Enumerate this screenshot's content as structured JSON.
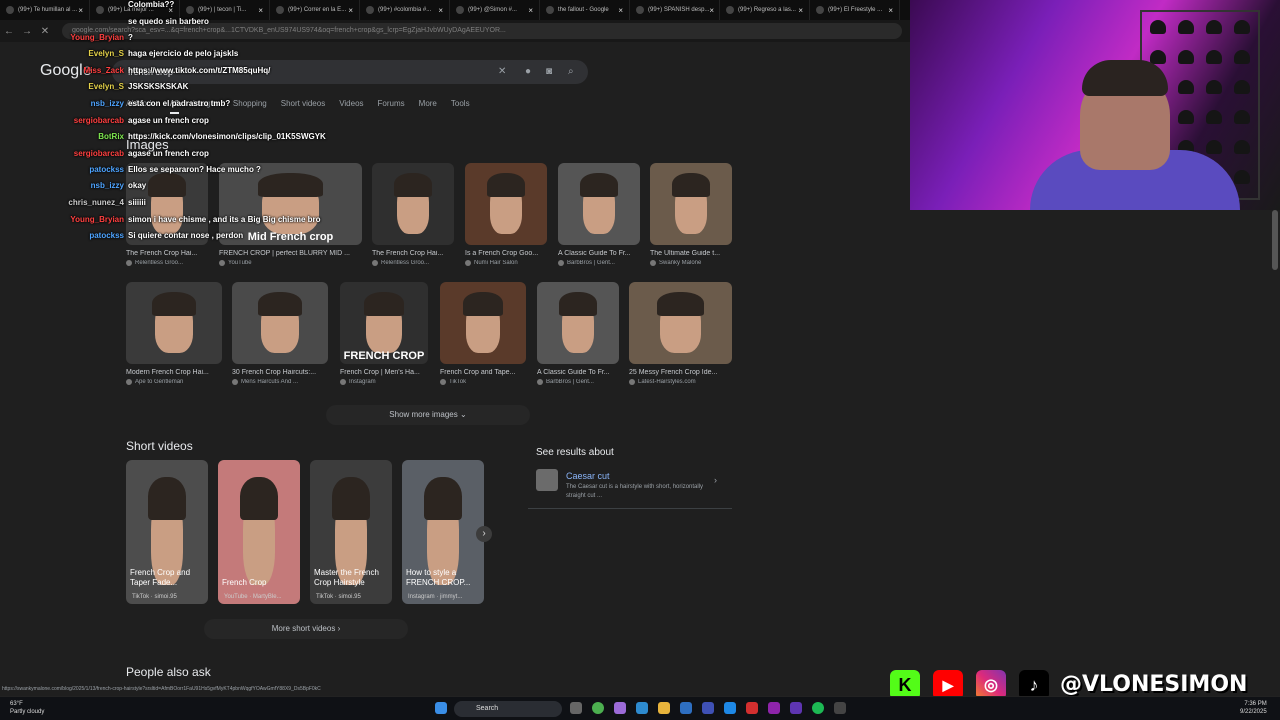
{
  "browser": {
    "tabs": [
      "(99+) Te humillan al ...",
      "(99+) La mejor ...",
      "(99+) | tecon | Ti...",
      "(99+) Correr en la E...",
      "(99+) #colombia #...",
      "(99+) @Simon #...",
      "the fallout - Google",
      "(99+) SPANISH desp...",
      "(99+) Regreso a las...",
      "(99+) El Freestyle ..."
    ],
    "url": "google.com/search?sca_esv=...&q=french+crop&...1CTVDKB_enUS974US974&oq=french+crop&gs_lcrp=EgZjaHJvbWUyDAgAEEUYOR..."
  },
  "google": {
    "logo": "Google",
    "query": "french crop",
    "filters": [
      "AI Mode",
      "All",
      "Images",
      "Shopping",
      "Short videos",
      "Videos",
      "Forums",
      "More",
      "Tools"
    ],
    "images_heading": "Images",
    "row1": [
      {
        "title": "The French Crop Hai...",
        "source": "Relentless Groo..."
      },
      {
        "title": "FRENCH CROP | perfect BLURRY MID ...",
        "source": "YouTube",
        "overlay": "Mid French crop"
      },
      {
        "title": "The French Crop Hai...",
        "source": "Relentless Groo..."
      },
      {
        "title": "Is a French Crop Goo...",
        "source": "Numi Hair Salon"
      },
      {
        "title": "A Classic Guide To Fr...",
        "source": "BarbBros | Gent..."
      },
      {
        "title": "The Ultimate Guide t...",
        "source": "Swanky Malone"
      }
    ],
    "row2": [
      {
        "title": "Modern French Crop Hai...",
        "source": "Ape to Gentleman"
      },
      {
        "title": "30 French Crop Haircuts:...",
        "source": "Mens Haircuts And ..."
      },
      {
        "title": "French Crop | Men's Ha...",
        "source": "Instagram",
        "overlay": "FRENCH CROP"
      },
      {
        "title": "French Crop and Tape...",
        "source": "TikTok"
      },
      {
        "title": "A Classic Guide To Fr...",
        "source": "BarbBros | Gent..."
      },
      {
        "title": "25 Messy French Crop Ide...",
        "source": "Latest-Hairstyles.com"
      }
    ],
    "show_more_images": "Show more images",
    "short_videos_heading": "Short videos",
    "short_videos": [
      {
        "title": "French Crop and Taper Fade...",
        "source": "TikTok · simoi.95"
      },
      {
        "title": "French Crop",
        "source": "YouTube · MartyBle..."
      },
      {
        "title": "Master the French Crop Hairstyle",
        "source": "TikTok · simoi.95"
      },
      {
        "title": "How to style a FRENCH CROP...",
        "source": "Instagram · jimmyt..."
      }
    ],
    "more_short_videos": "More short videos",
    "see_results": {
      "heading": "See results about",
      "title": "Caesar cut",
      "desc": "The Caesar cut is a hairstyle with short, horizontally straight cut ..."
    },
    "people_also_ask": "People also ask"
  },
  "chat": [
    {
      "user": "",
      "msg": "Colombia??",
      "color": "#ffffff"
    },
    {
      "user": "",
      "msg": "se quedo sin barbero",
      "color": "#ffffff"
    },
    {
      "user": "Young_Bryian",
      "msg": "?",
      "color": "#ff4040"
    },
    {
      "user": "Evelyn_S",
      "msg": "haga ejercicio de pelo jajskls",
      "color": "#e6d34a"
    },
    {
      "user": "Miss_Zack",
      "msg": "https://www.tiktok.com/t/ZTM85quHq/",
      "color": "#ff4040"
    },
    {
      "user": "Evelyn_S",
      "msg": "JSKSKSKSKAK",
      "color": "#e6d34a"
    },
    {
      "user": "nsb_izzy",
      "msg": "está con el padrastro tmb?",
      "color": "#4ea4ff"
    },
    {
      "user": "sergiobarcab",
      "msg": "agase un french crop",
      "color": "#ff4040"
    },
    {
      "user": "BotRix",
      "msg": "https://kick.com/vlonesimon/clips/clip_01K5SWGYK",
      "color": "#7ee84f"
    },
    {
      "user": "sergiobarcab",
      "msg": "agase un french crop",
      "color": "#ff4040"
    },
    {
      "user": "patockss",
      "msg": "Ellos se separaron? Hace mucho ?",
      "color": "#4ea4ff"
    },
    {
      "user": "nsb_izzy",
      "msg": "okay",
      "color": "#4ea4ff"
    },
    {
      "user": "chris_nunez_4",
      "msg": "siiiiii",
      "color": "#cccccc"
    },
    {
      "user": "Young_Bryian",
      "msg": "simon i have chisme , and its a Big Big chisme bro",
      "color": "#ff4040"
    },
    {
      "user": "patockss",
      "msg": "Si quiere contar nose , perdon",
      "color": "#4ea4ff"
    }
  ],
  "status_link": "https://swankymalone.com/blog/2025/1/13/french-crop-hairstyle?srsltid=AfmBOorr1FaU91Hs5gvfMyKT4pbnWqgfYOAwGmfY88X9_Ds5BpF0kC",
  "taskbar": {
    "weather_temp": "63°F",
    "weather_desc": "Partly cloudy",
    "search": "Search",
    "time": "7:36 PM",
    "date": "9/22/2025"
  },
  "socials": {
    "handle": "@VLONESIMON",
    "icons": [
      "kick-icon",
      "youtube-icon",
      "instagram-icon",
      "tiktok-icon"
    ]
  }
}
